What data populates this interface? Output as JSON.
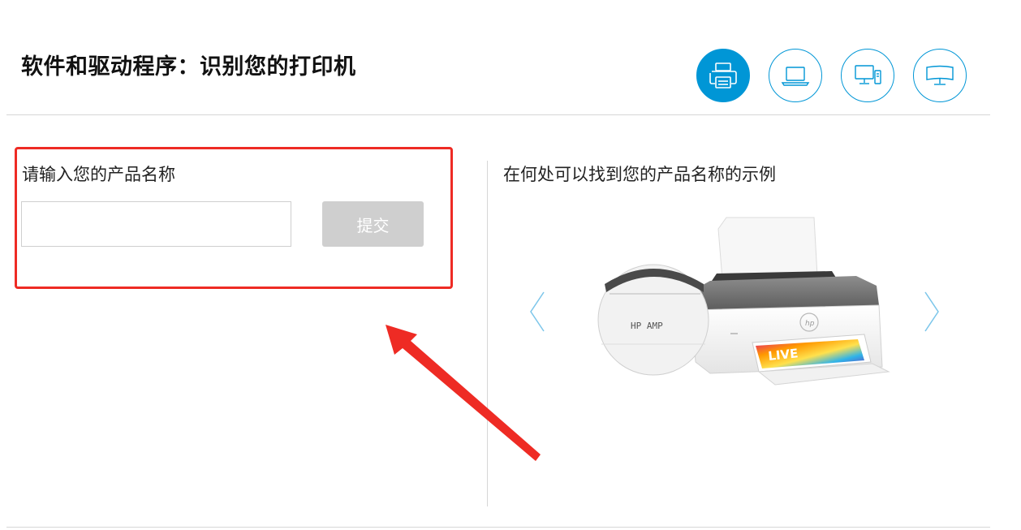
{
  "header": {
    "title": "软件和驱动程序：识别您的打印机",
    "device_icons": [
      {
        "name": "printer-icon",
        "active": true
      },
      {
        "name": "laptop-icon",
        "active": false
      },
      {
        "name": "desktop-icon",
        "active": false
      },
      {
        "name": "monitor-icon",
        "active": false
      }
    ]
  },
  "form": {
    "label": "请输入您的产品名称",
    "input_value": "",
    "input_placeholder": "",
    "submit_label": "提交"
  },
  "example": {
    "title": "在何处可以找到您的产品名称的示例",
    "magnifier_text": "HP AMP",
    "paper_text": "LIVE"
  },
  "colors": {
    "accent": "#0096d6",
    "highlight_border": "#ee2b24",
    "button_disabled": "#cfcfcf",
    "divider": "#d6d6d6"
  }
}
